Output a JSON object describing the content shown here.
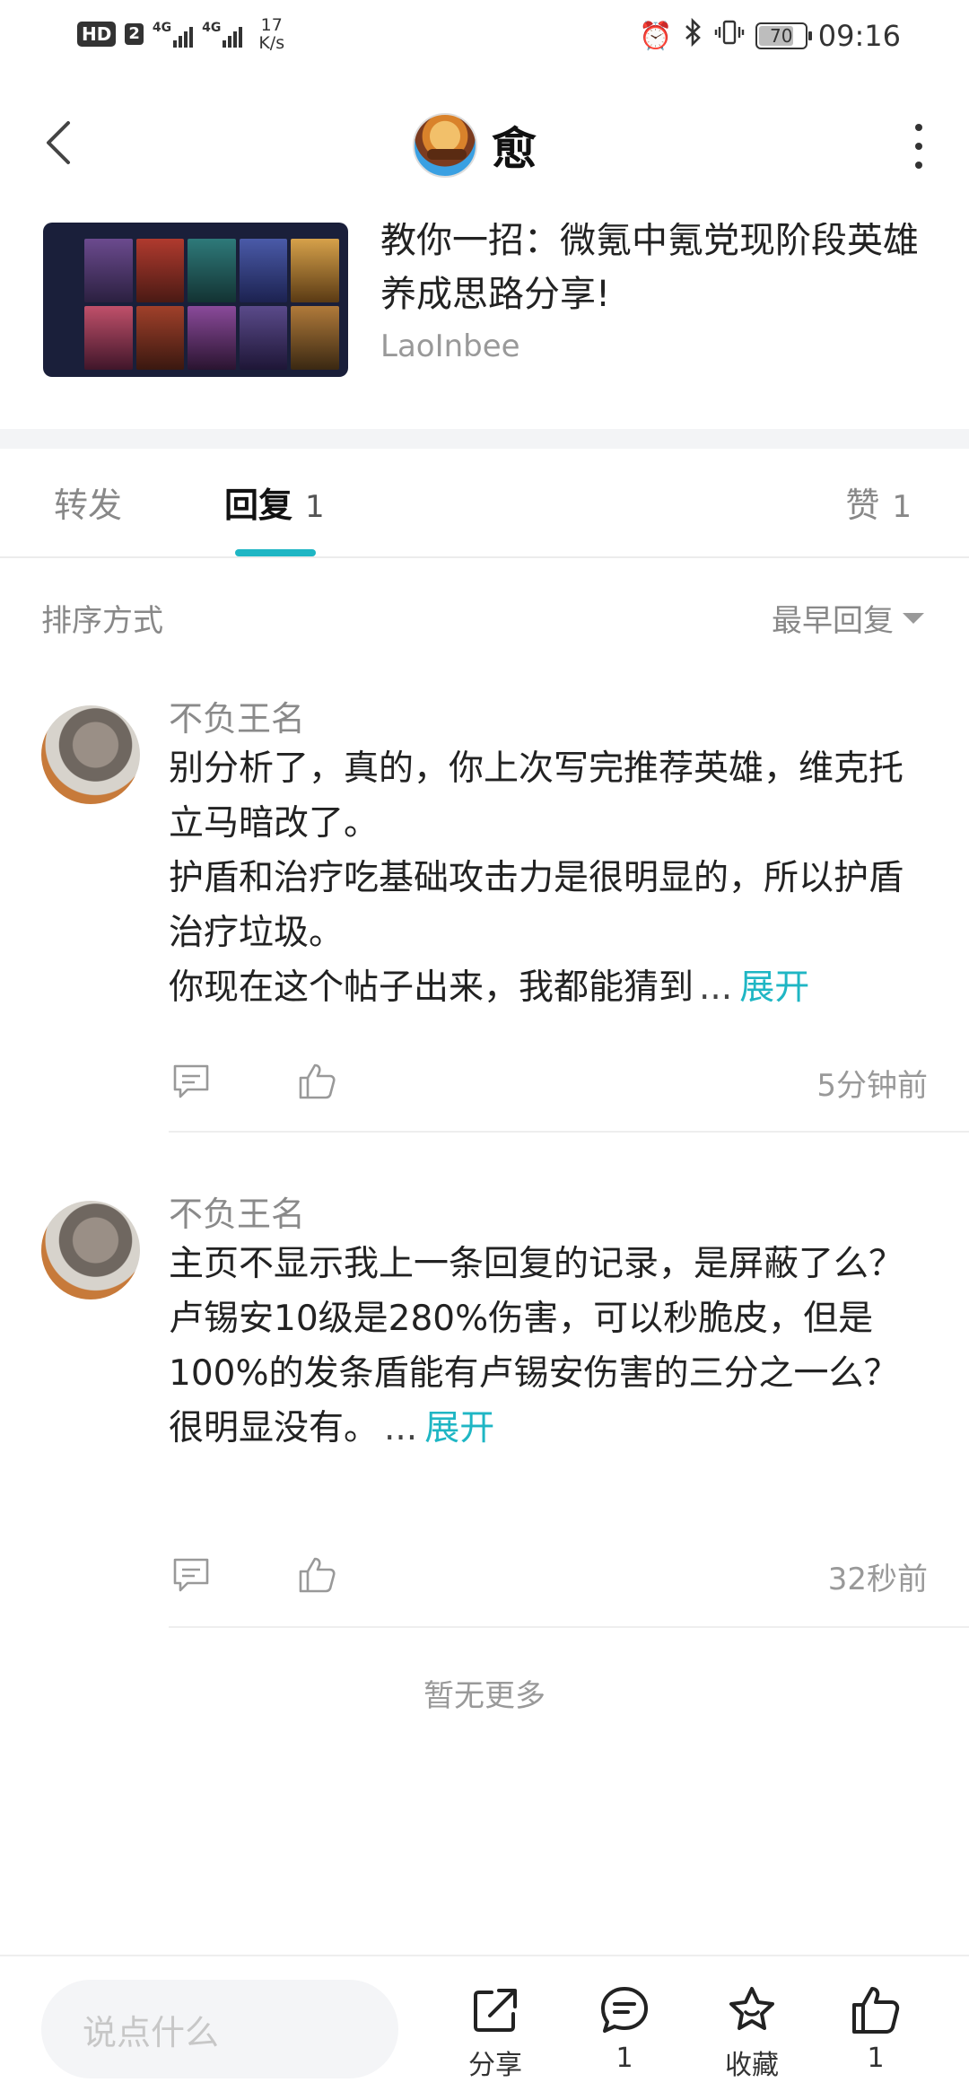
{
  "status_bar": {
    "hd": "HD",
    "sim": "2",
    "net1": "4G",
    "net2": "4G",
    "speed_value": "17",
    "speed_unit": "K/s",
    "battery": "70",
    "time": "09:16"
  },
  "header": {
    "title": "愈"
  },
  "post": {
    "title": "教你一招：微氪中氪党现阶段英雄养成思路分享!",
    "author": "LaoInbee"
  },
  "tabs": {
    "forward_label": "转发",
    "reply_label": "回复",
    "reply_count": "1",
    "like_label": "赞",
    "like_count": "1"
  },
  "sort": {
    "label": "排序方式",
    "selected": "最早回复"
  },
  "comments": [
    {
      "name": "不负王名",
      "text": "别分析了，真的，你上次写完推荐英雄，维克托立马暗改了。\n护盾和治疗吃基础攻击力是很明显的，所以护盾治疗垃圾。\n你现在这个帖子出来，我都能猜到",
      "ellipsis": "...",
      "expand": "展开",
      "time": "5分钟前"
    },
    {
      "name": "不负王名",
      "text": "主页不显示我上一条回复的记录，是屏蔽了么？\n卢锡安10级是280%伤害，可以秒脆皮，但是100%的发条盾能有卢锡安伤害的三分之一么？很明显没有。",
      "ellipsis": "...",
      "expand": "展开",
      "time": "32秒前"
    }
  ],
  "no_more": "暂无更多",
  "bottom_bar": {
    "input_placeholder": "说点什么",
    "share_label": "分享",
    "comment_count": "1",
    "fav_label": "收藏",
    "like_count": "1"
  },
  "colors": {
    "accent": "#1fb6c4",
    "muted_text": "#999999",
    "divider": "#eeeeee"
  }
}
